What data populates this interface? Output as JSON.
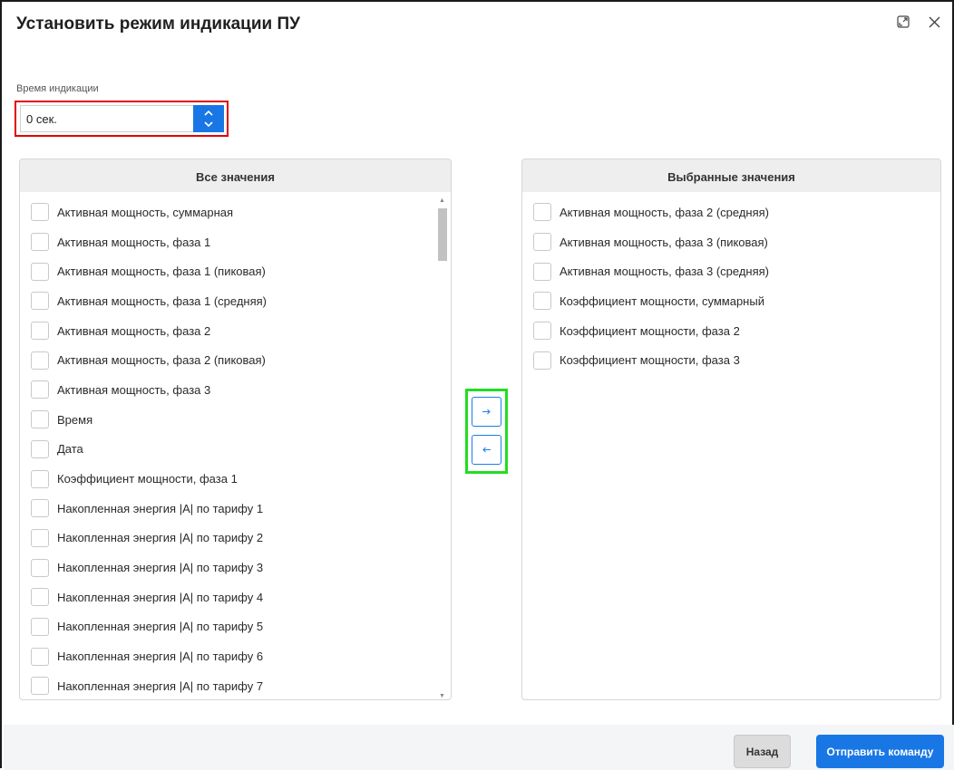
{
  "dialog": {
    "title": "Установить режим индикации ПУ",
    "icons": {
      "expand": "expand-icon",
      "close": "close-icon"
    }
  },
  "display_time": {
    "label": "Время индикации",
    "value": "0 сек."
  },
  "all_values": {
    "header": "Все значения",
    "items": [
      "Активная мощность, суммарная",
      "Активная мощность, фаза 1",
      "Активная мощность, фаза 1 (пиковая)",
      "Активная мощность, фаза 1 (средняя)",
      "Активная мощность, фаза 2",
      "Активная мощность, фаза 2 (пиковая)",
      "Активная мощность, фаза 3",
      "Время",
      "Дата",
      "Коэффициент мощности, фаза 1",
      "Накопленная энергия |A| по тарифу 1",
      "Накопленная энергия |A| по тарифу 2",
      "Накопленная энергия |A| по тарифу 3",
      "Накопленная энергия |A| по тарифу 4",
      "Накопленная энергия |A| по тарифу 5",
      "Накопленная энергия |A| по тарифу 6",
      "Накопленная энергия |A| по тарифу 7"
    ]
  },
  "selected_values": {
    "header": "Выбранные значения",
    "items": [
      "Активная мощность, фаза 2 (средняя)",
      "Активная мощность, фаза 3 (пиковая)",
      "Активная мощность, фаза 3 (средняя)",
      "Коэффициент мощности, суммарный",
      "Коэффициент мощности, фаза 2",
      "Коэффициент мощности, фаза 3"
    ]
  },
  "transfer": {
    "right_icon": "arrow-right-icon",
    "left_icon": "arrow-left-icon"
  },
  "footer": {
    "back_label": "Назад",
    "send_label": "Отправить команду"
  },
  "colors": {
    "accent": "#1877e5",
    "highlight_red": "#e00000",
    "highlight_green": "#22dd22"
  }
}
